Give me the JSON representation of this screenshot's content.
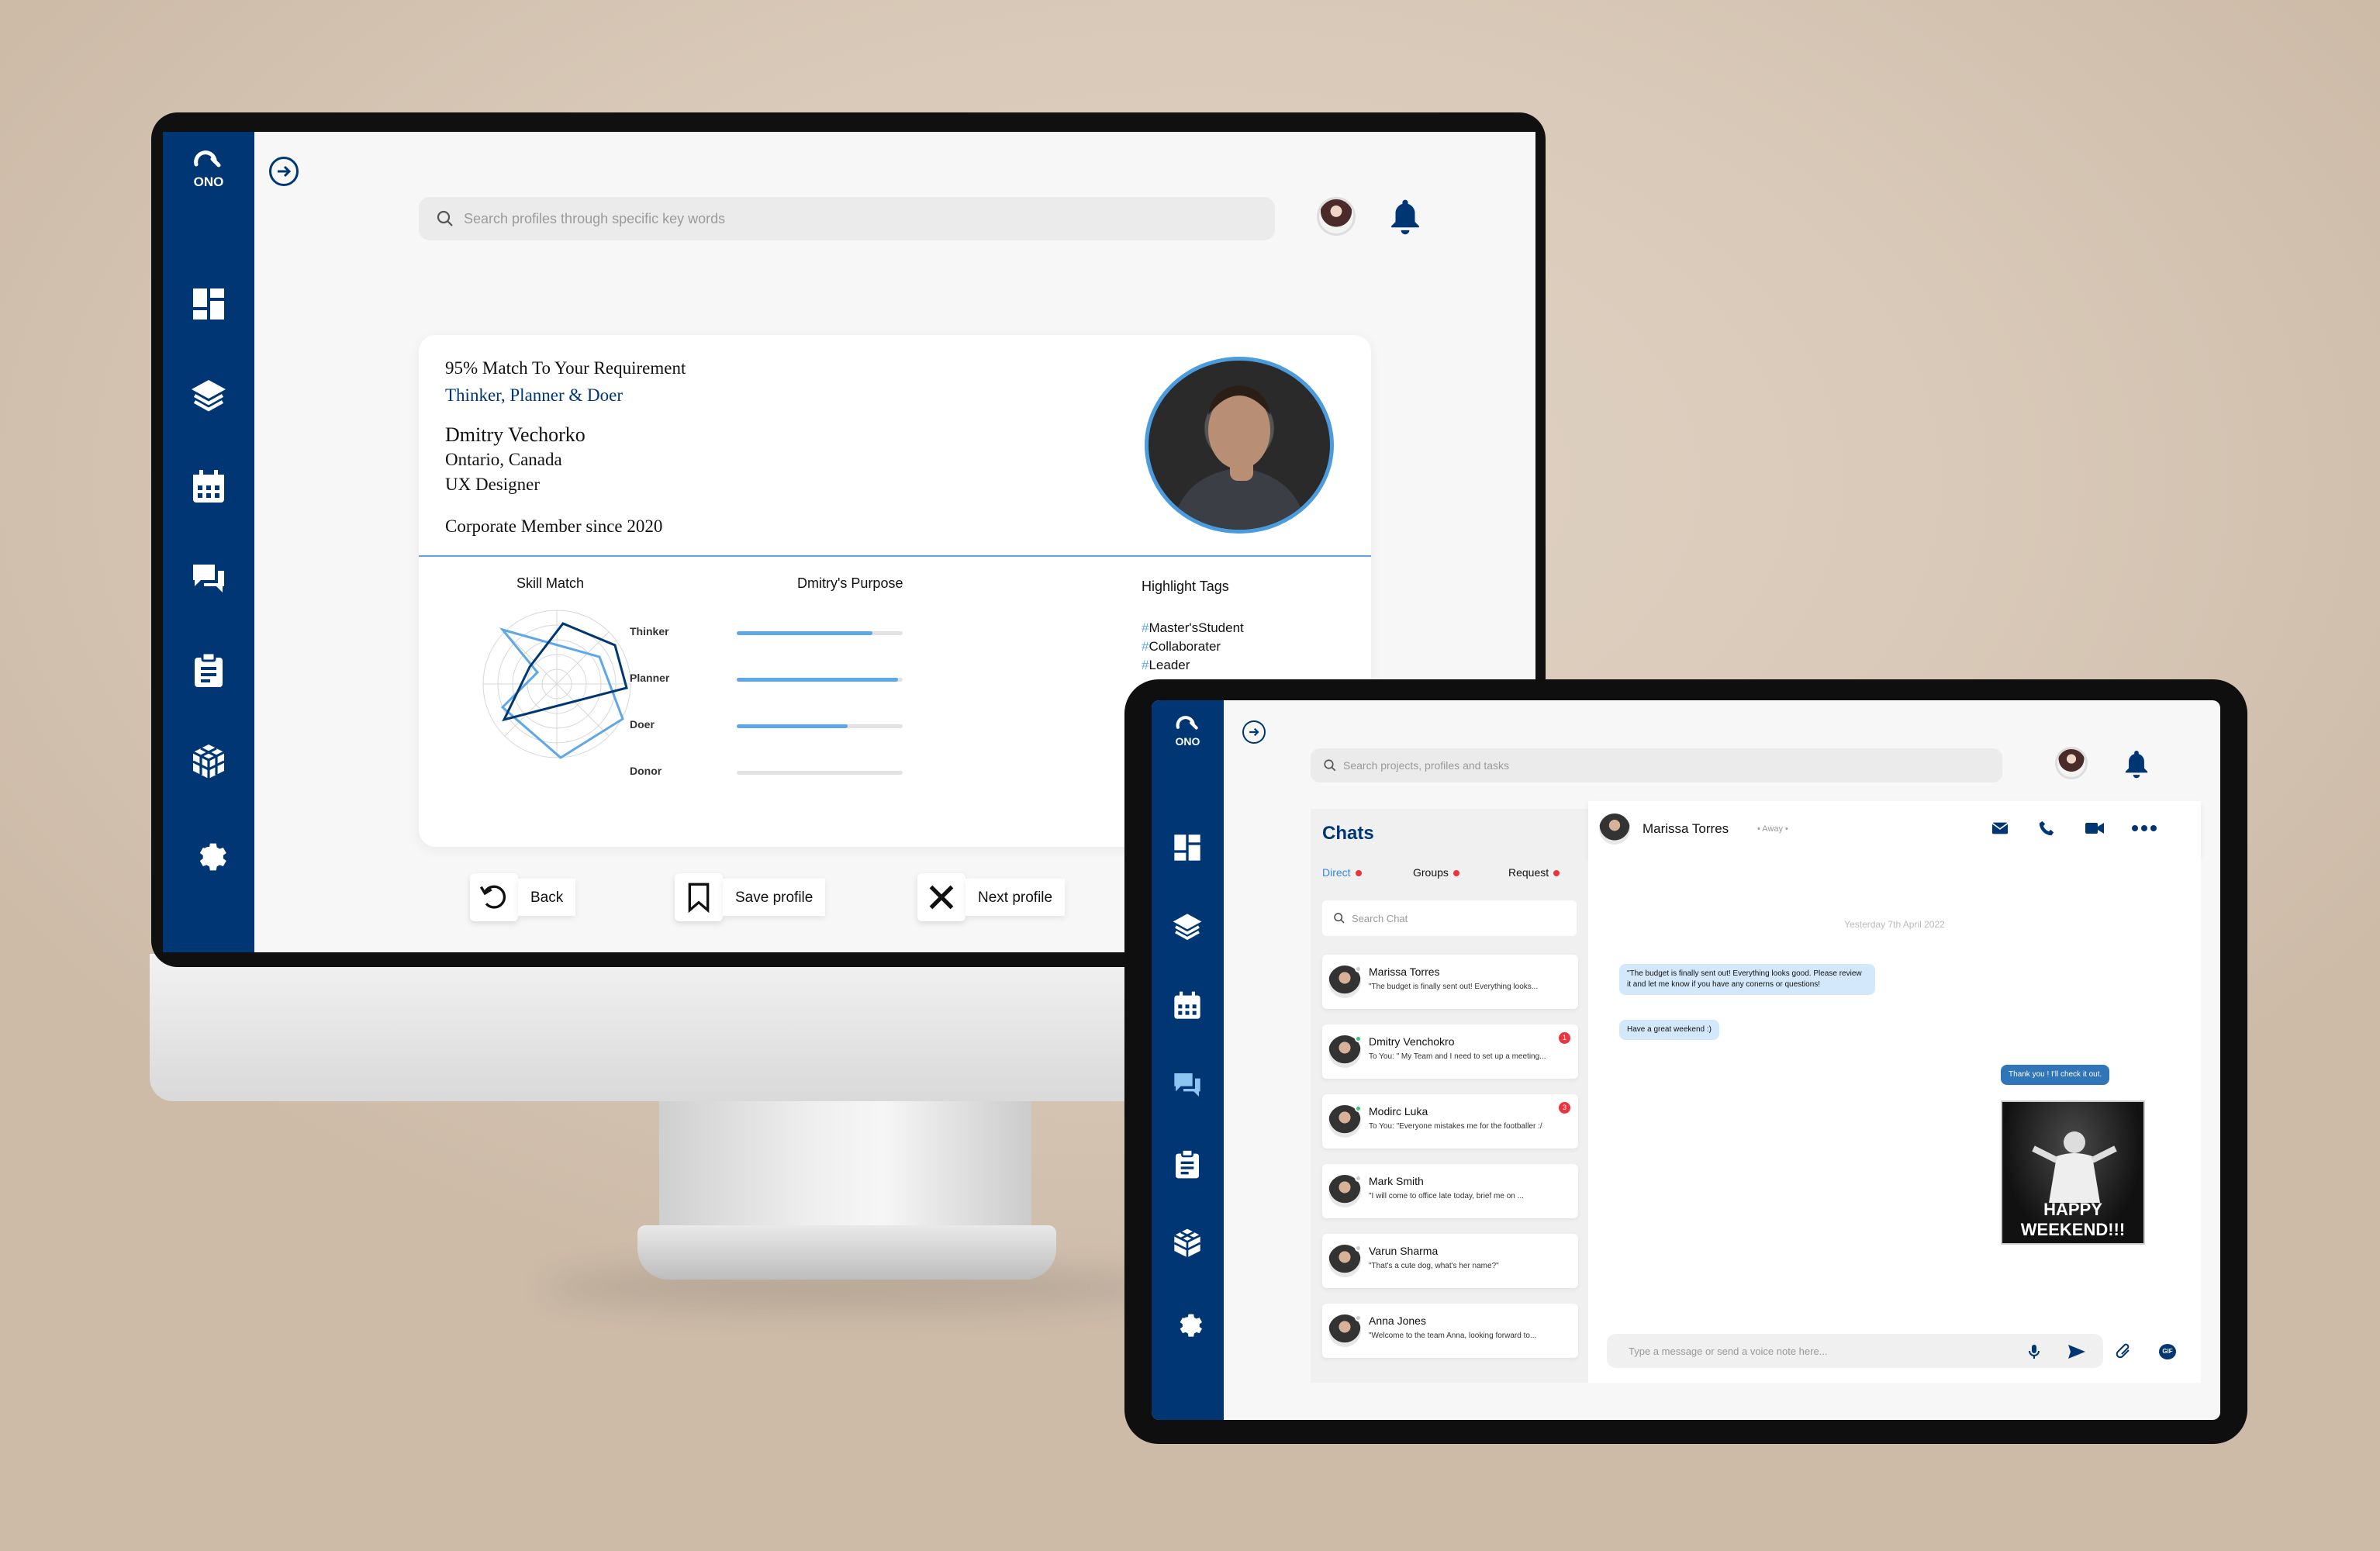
{
  "app": {
    "logo_text": "ONO"
  },
  "desktop": {
    "search_placeholder": "Search profiles through specific key words",
    "profile": {
      "match": "95% Match To Your Requirement",
      "traits": "Thinker, Planner & Doer",
      "name": "Dmitry Vechorko",
      "location": "Ontario, Canada",
      "role": "UX Designer",
      "member_since": "Corporate Member since 2020"
    },
    "skill_match_title": "Skill Match",
    "purpose_title": "Dmitry's Purpose",
    "purpose": [
      {
        "label": "Thinker",
        "value": 0.82
      },
      {
        "label": "Planner",
        "value": 0.97
      },
      {
        "label": "Doer",
        "value": 0.67
      },
      {
        "label": "Donor",
        "value": 0.0
      }
    ],
    "highlight_title": "Highlight Tags",
    "tags": [
      "Master'sStudent",
      "Collaborater",
      "Leader"
    ],
    "actions": {
      "back": "Back",
      "save": "Save profile",
      "next": "Next profile"
    }
  },
  "tablet": {
    "search_placeholder": "Search projects, profiles and tasks",
    "chats_title": "Chats",
    "tabs": [
      "Direct",
      "Groups",
      "Request"
    ],
    "chat_search_placeholder": "Search Chat",
    "chats": [
      {
        "name": "Marissa Torres",
        "msg": "\"The budget is finally sent out! Everything looks...",
        "badge": ""
      },
      {
        "name": "Dmitry Venchokro",
        "msg": "To You: \" My Team and I need to set up a meeting...",
        "badge": "1"
      },
      {
        "name": "Modirc Luka",
        "msg": "To You: \"Everyone mistakes me for the footballer :/",
        "badge": "3"
      },
      {
        "name": "Mark Smith",
        "msg": "\"I will come to office late today, brief me on ...",
        "badge": ""
      },
      {
        "name": "Varun Sharma",
        "msg": "\"That's a cute dog, what's her name?\"",
        "badge": ""
      },
      {
        "name": "Anna Jones",
        "msg": "\"Welcome to the team Anna, looking forward to...",
        "badge": ""
      }
    ],
    "active_chat": {
      "name": "Marissa Torres",
      "status": "• Away •"
    },
    "date_divider": "Yesterday 7th April 2022",
    "messages": {
      "in1": "\"The budget is finally sent out! Everything looks good. Please review it and let me know if you have any conerns or questions!",
      "in2": "Have a great weekend :)",
      "out1": "Thank you ! I'll check it out.",
      "gif_text_1": "HAPPY",
      "gif_text_2": "WEEKEND!!!"
    },
    "message_placeholder": "Type a message or send a voice note here...",
    "gif_button": "GIF"
  },
  "colors": {
    "primary": "#003674",
    "accent": "#5fa8e8",
    "badge": "#e8353f"
  }
}
